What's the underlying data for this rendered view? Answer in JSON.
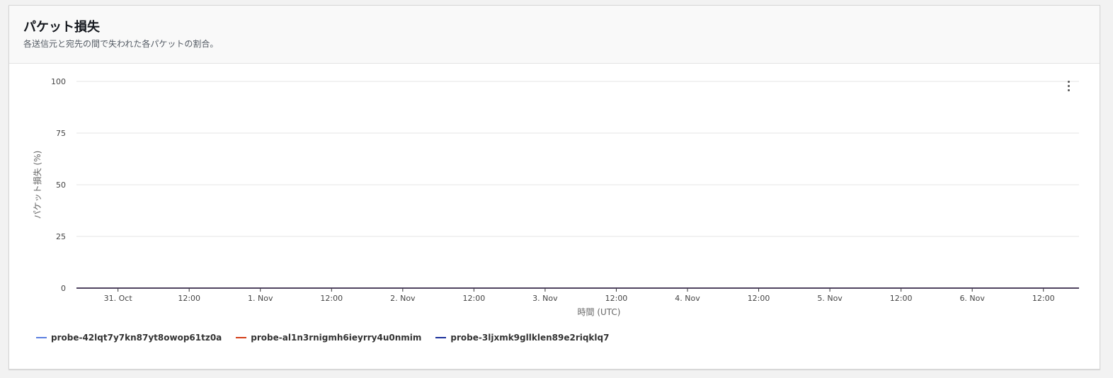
{
  "panel": {
    "title": "パケット損失",
    "subtitle": "各送信元と宛先の間で失われた各パケットの割合。"
  },
  "icons": {
    "menu": "more-vertical-icon"
  },
  "chart_data": {
    "type": "line",
    "xlabel": "時間 (UTC)",
    "ylabel": "パケット損失 (%)",
    "ylim": [
      0,
      100
    ],
    "yticks": [
      0,
      25,
      50,
      75,
      100
    ],
    "xlim": [
      "2023-10-30T17:00",
      "2023-11-06T18:00"
    ],
    "xticks": [
      {
        "t": "2023-10-31T00:00",
        "label": "31. Oct"
      },
      {
        "t": "2023-10-31T12:00",
        "label": "12:00"
      },
      {
        "t": "2023-11-01T00:00",
        "label": "1. Nov"
      },
      {
        "t": "2023-11-01T12:00",
        "label": "12:00"
      },
      {
        "t": "2023-11-02T00:00",
        "label": "2. Nov"
      },
      {
        "t": "2023-11-02T12:00",
        "label": "12:00"
      },
      {
        "t": "2023-11-03T00:00",
        "label": "3. Nov"
      },
      {
        "t": "2023-11-03T12:00",
        "label": "12:00"
      },
      {
        "t": "2023-11-04T00:00",
        "label": "4. Nov"
      },
      {
        "t": "2023-11-04T12:00",
        "label": "12:00"
      },
      {
        "t": "2023-11-05T00:00",
        "label": "5. Nov"
      },
      {
        "t": "2023-11-05T12:00",
        "label": "12:00"
      },
      {
        "t": "2023-11-06T00:00",
        "label": "6. Nov"
      },
      {
        "t": "2023-11-06T12:00",
        "label": "12:00"
      }
    ],
    "grid": true,
    "legend_position": "bottom-left",
    "series": [
      {
        "name": "probe-42lqt7y7kn87yt8owop61tz0a",
        "color": "#5b7fe0",
        "x": [
          "2023-10-30T17:00",
          "2023-11-06T18:00"
        ],
        "y": [
          0,
          0
        ]
      },
      {
        "name": "probe-al1n3rnigmh6ieyrry4u0nmim",
        "color": "#d33d17",
        "x": [
          "2023-10-30T17:00",
          "2023-11-06T18:00"
        ],
        "y": [
          0,
          0
        ]
      },
      {
        "name": "probe-3ljxmk9gllklen89e2riqklq7",
        "color": "#1a2f9a",
        "x": [
          "2023-10-30T17:00",
          "2023-11-06T18:00"
        ],
        "y": [
          0,
          0
        ]
      }
    ]
  }
}
